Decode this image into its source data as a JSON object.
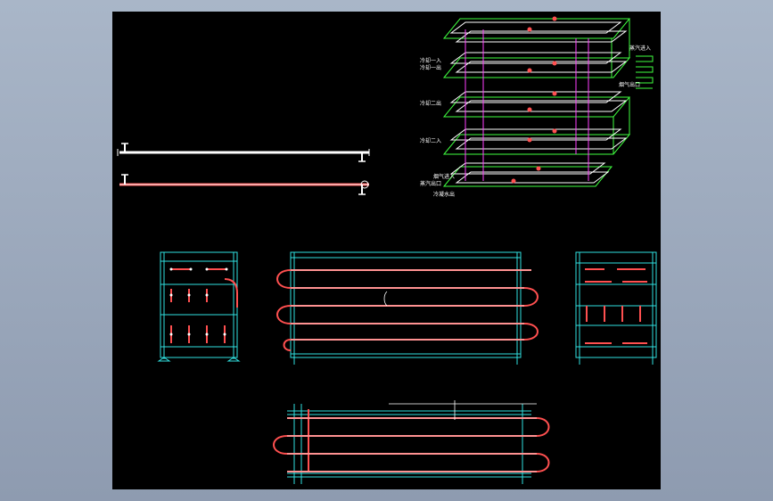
{
  "iso_labels": [
    {
      "id": "steam_in",
      "text": "蒸汽进入"
    },
    {
      "id": "cooling_1_in",
      "text": "冷却一入"
    },
    {
      "id": "cooling_1_out",
      "text": "冷却一出"
    },
    {
      "id": "cooling_2_out",
      "text": "冷却二出"
    },
    {
      "id": "cooling_2_in",
      "text": "冷却二入"
    },
    {
      "id": "gas_out",
      "text": "蒸汽出口"
    },
    {
      "id": "water_out",
      "text": "冷凝水出"
    },
    {
      "id": "flue_in",
      "text": "烟气进入"
    },
    {
      "id": "flue_out",
      "text": "烟气出口"
    }
  ],
  "colors": {
    "background_outer": "#98a5b9",
    "drawing_area": "#000000",
    "frame": "#30e0e0",
    "pipe": "#ff5050",
    "pipe_core": "#ffffff",
    "iso_green": "#40ff40",
    "iso_magenta": "#ff40ff"
  }
}
